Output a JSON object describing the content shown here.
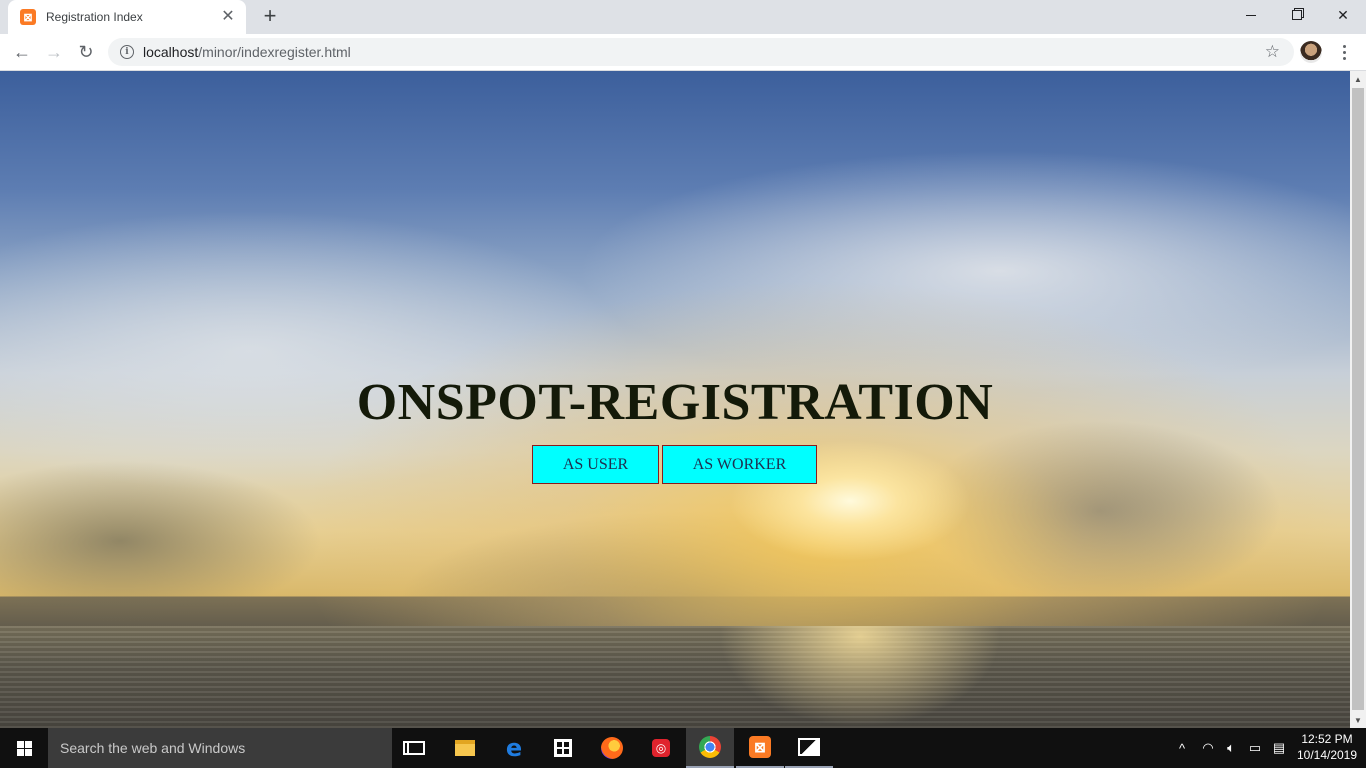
{
  "browser": {
    "tab": {
      "title": "Registration Index",
      "favicon": "xampp-icon",
      "close": "✕"
    },
    "new_tab": "+",
    "window": {
      "minimize": "minimize-icon",
      "maximize": "restore-icon",
      "close": "✕"
    },
    "nav": {
      "back": "←",
      "forward": "→",
      "reload": "↻"
    },
    "address": {
      "host": "localhost",
      "path": "/minor/indexregister.html",
      "info": "i"
    },
    "bookmark": "☆"
  },
  "page": {
    "heading": "ONSPOT-REGISTRATION",
    "buttons": {
      "user": "AS USER",
      "worker": "AS WORKER"
    },
    "colors": {
      "button_bg": "#00ffff",
      "heading": "#141a09"
    }
  },
  "scrollbar": {
    "up": "▲",
    "down": "▼"
  },
  "taskbar": {
    "search_placeholder": "Search the web and Windows",
    "edge": "e",
    "tray": {
      "chevron": "^",
      "network": "wifi-icon",
      "volume": "volume-icon",
      "battery": "battery-icon",
      "notifications": "notification-icon"
    },
    "clock": {
      "time": "12:52 PM",
      "date": "10/14/2019"
    }
  }
}
